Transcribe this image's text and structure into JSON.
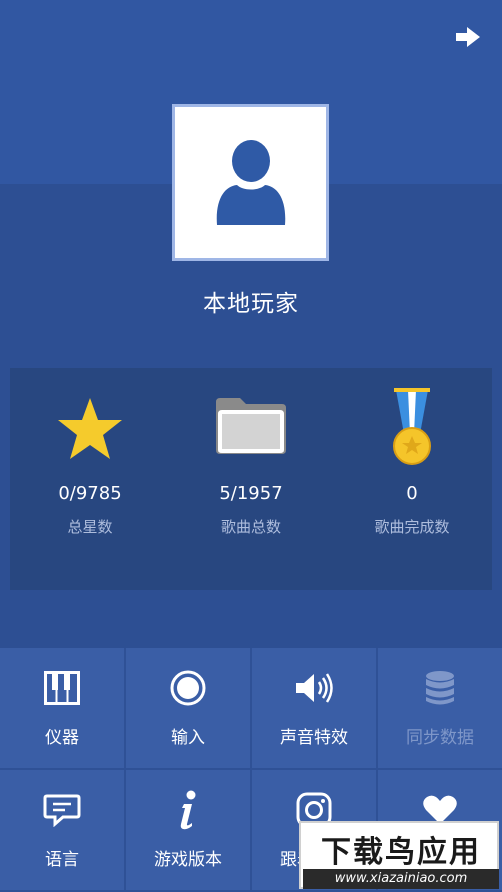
{
  "player": {
    "name": "本地玩家"
  },
  "stats": [
    {
      "icon": "star-icon",
      "value": "0/9785",
      "label": "总星数"
    },
    {
      "icon": "folder-icon",
      "value": "5/1957",
      "label": "歌曲总数"
    },
    {
      "icon": "medal-icon",
      "value": "0",
      "label": "歌曲完成数"
    }
  ],
  "menu": [
    {
      "icon": "piano-icon",
      "label": "仪器",
      "enabled": true
    },
    {
      "icon": "record-icon",
      "label": "输入",
      "enabled": true
    },
    {
      "icon": "speaker-icon",
      "label": "声音特效",
      "enabled": true
    },
    {
      "icon": "database-icon",
      "label": "同步数据",
      "enabled": false
    },
    {
      "icon": "chat-icon",
      "label": "语言",
      "enabled": true
    },
    {
      "icon": "info-icon",
      "label": "游戏版本",
      "enabled": true
    },
    {
      "icon": "instagram-icon",
      "label": "跟着我们",
      "enabled": true
    },
    {
      "icon": "heart-icon",
      "label": "",
      "enabled": true
    }
  ],
  "watermark": {
    "title": "下载鸟应用",
    "url": "www.xiazainiao.com"
  },
  "colors": {
    "background": "#2f5196",
    "panel": "#284780",
    "cell": "#3a5ea6",
    "star": "#f5cb2c",
    "medal": "#f5c52a"
  }
}
